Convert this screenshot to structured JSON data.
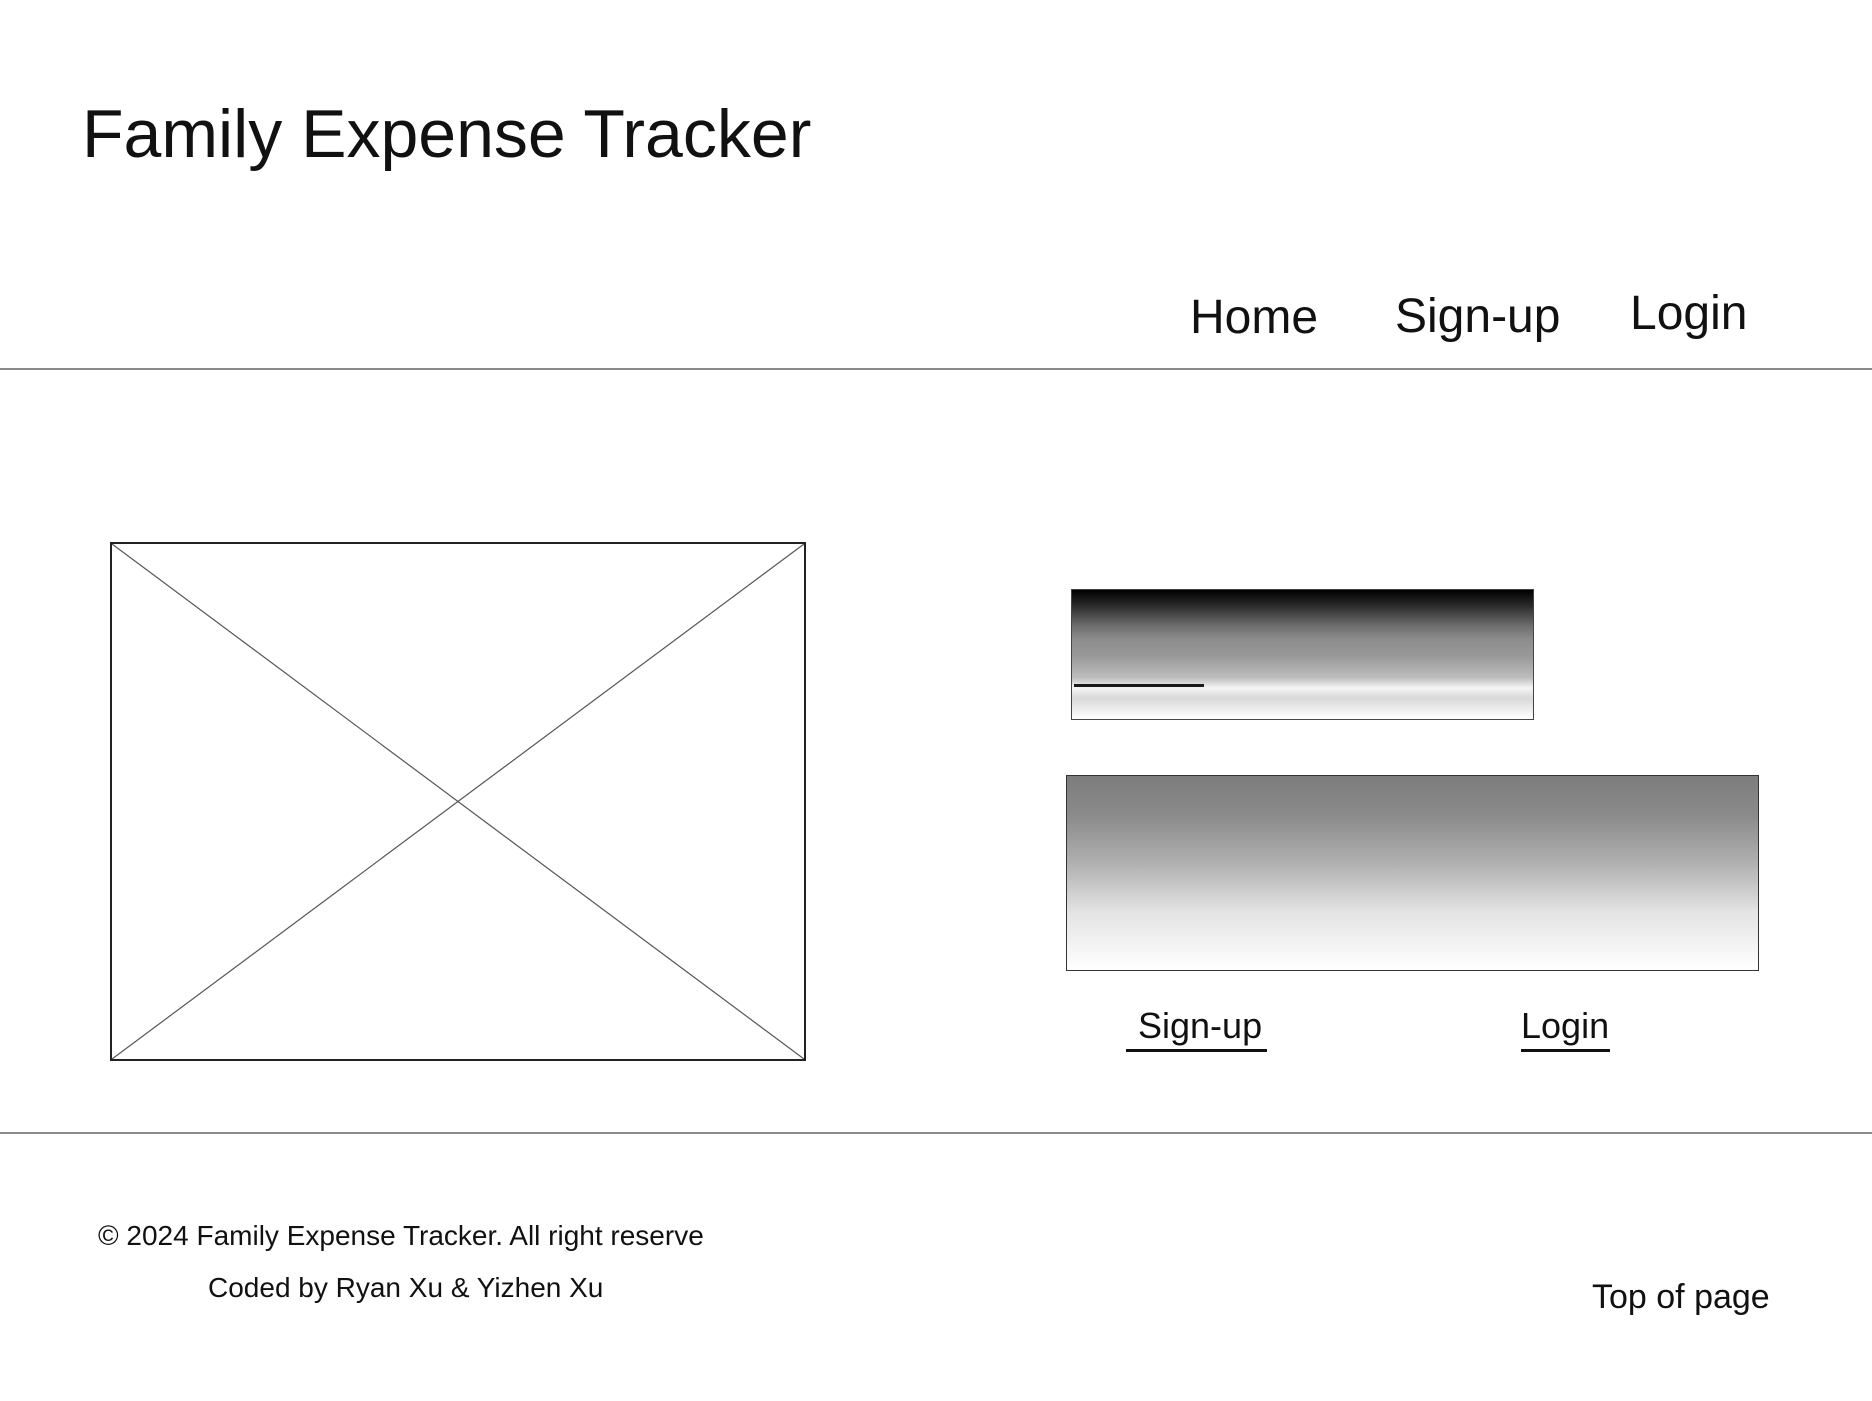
{
  "header": {
    "title": "Family Expense Tracker"
  },
  "nav": {
    "items": [
      {
        "label": "Home"
      },
      {
        "label": "Sign-up"
      },
      {
        "label": "Login"
      }
    ]
  },
  "main": {
    "image_placeholder_icon": "image-placeholder-cross",
    "actions": {
      "signup_label": "Sign-up",
      "login_label": "Login"
    }
  },
  "footer": {
    "copyright": "© 2024 Family Expense Tracker. All right reserve",
    "credits": "Coded by Ryan Xu & Yizhen Xu",
    "top_link": "Top of page"
  }
}
